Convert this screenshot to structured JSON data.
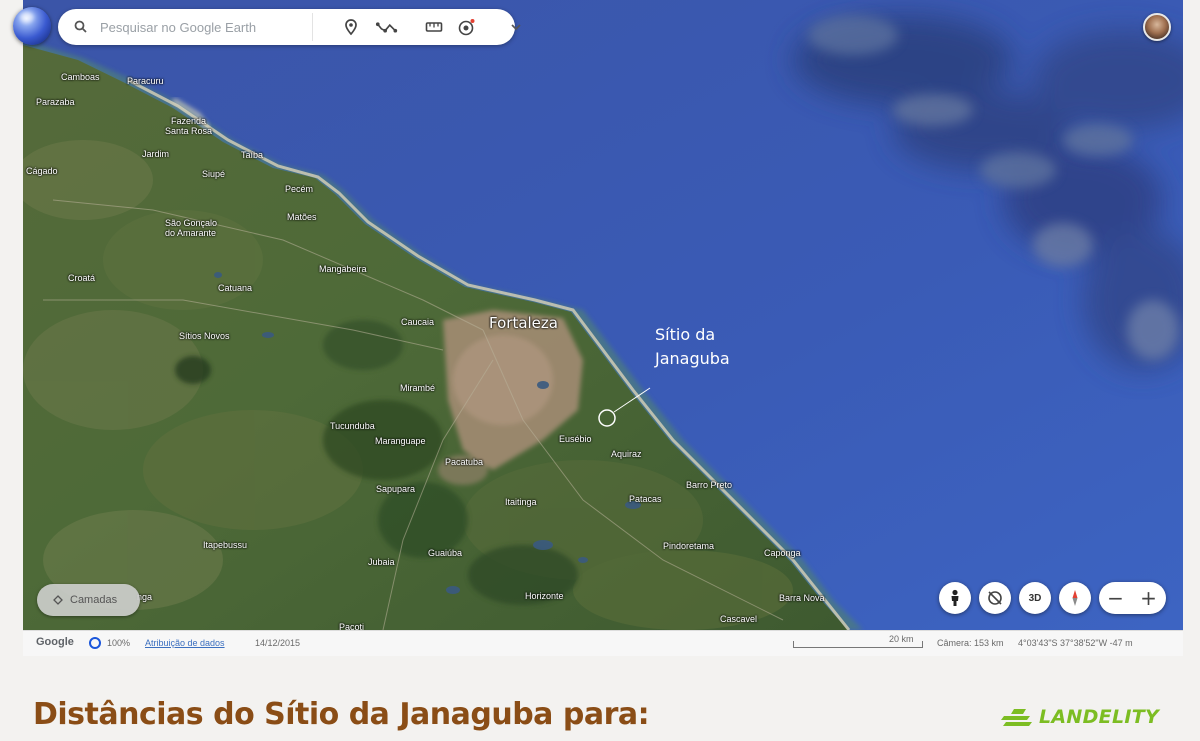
{
  "search": {
    "placeholder": "Pesquisar no Google Earth"
  },
  "toolbar": {
    "icons": [
      "place-pin-icon",
      "path-icon",
      "ruler-icon",
      "voyager-icon",
      "chevron-down-icon"
    ]
  },
  "map": {
    "places": [
      {
        "name": "Camboas"
      },
      {
        "name": "Paracuru"
      },
      {
        "name": "Parazaba"
      },
      {
        "name": "Fazenda\nSanta Rosa"
      },
      {
        "name": "Jardim"
      },
      {
        "name": "Taíba"
      },
      {
        "name": "Cágado"
      },
      {
        "name": "Siupé"
      },
      {
        "name": "Pecém"
      },
      {
        "name": "Matões"
      },
      {
        "name": "São Gonçalo\ndo Amarante"
      },
      {
        "name": "Mangabeira"
      },
      {
        "name": "Croatá"
      },
      {
        "name": "Catuana"
      },
      {
        "name": "Sítios Novos"
      },
      {
        "name": "Caucaia"
      },
      {
        "name": "Fortaleza"
      },
      {
        "name": "Mirambé"
      },
      {
        "name": "Tucunduba"
      },
      {
        "name": "Maranguape"
      },
      {
        "name": "Eusébio"
      },
      {
        "name": "Aquiraz"
      },
      {
        "name": "Pacatuba"
      },
      {
        "name": "Sapupara"
      },
      {
        "name": "Itaitinga"
      },
      {
        "name": "Barro Preto"
      },
      {
        "name": "Patacas"
      },
      {
        "name": "Itapebussu"
      },
      {
        "name": "Pindoretama"
      },
      {
        "name": "Caponga"
      },
      {
        "name": "Guaiúba"
      },
      {
        "name": "Jubaia"
      },
      {
        "name": "Horizonte"
      },
      {
        "name": "Barra Nova"
      },
      {
        "name": "Cascavel"
      },
      {
        "name": "Pacoti"
      },
      {
        "name": "nga"
      }
    ],
    "annotation": "Sítio da\nJanaguba"
  },
  "layers": {
    "label": "Camadas"
  },
  "controls": {
    "street_view": "pegman-icon",
    "rotate": "rotate-icon",
    "view_3d": "3D",
    "compass": "compass-icon",
    "zoom_out": "−",
    "zoom_in": "+"
  },
  "status": {
    "brand": "Google",
    "percent": "100%",
    "attribution": "Atribuição de dados",
    "date": "14/12/2015",
    "scale": "20 km",
    "camera": "Câmera: 153 km",
    "coords": "4°03'43\"S 37°38'52\"W  -47 m"
  },
  "heading": "Distâncias do Sítio da Janaguba para:",
  "brand": {
    "name": "LANDELITY",
    "color": "#7cbd22"
  }
}
